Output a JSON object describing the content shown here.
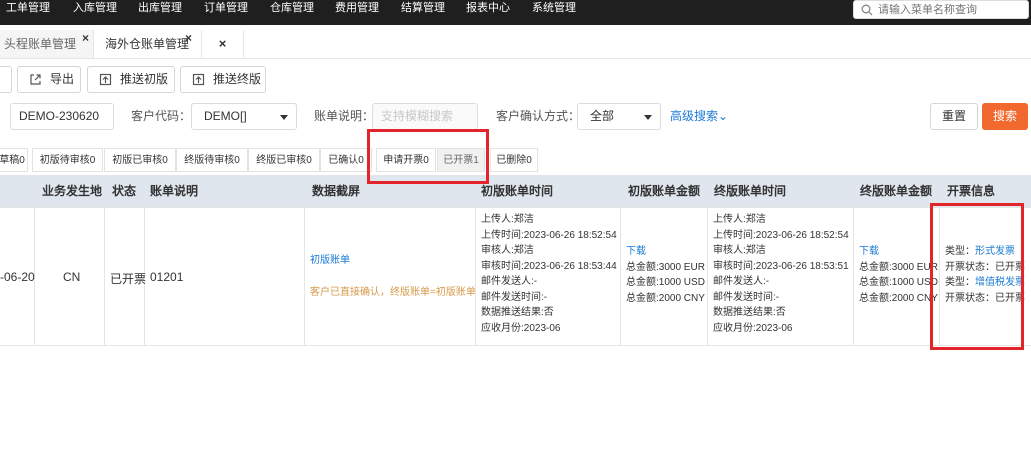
{
  "nav": {
    "items": [
      "工单管理",
      "入库管理",
      "出库管理",
      "订单管理",
      "仓库管理",
      "费用管理",
      "结算管理",
      "报表中心",
      "系统管理"
    ],
    "search_placeholder": "请输入菜单名称查询"
  },
  "tabs": {
    "items": [
      {
        "label": "头程账单管理",
        "close": "×"
      },
      {
        "label": "海外仓账单管理",
        "close": "×"
      }
    ],
    "close_all": "×"
  },
  "toolbar": {
    "export": "导出",
    "push_initial": "推送初版",
    "push_final": "推送终版"
  },
  "filters": {
    "bill_no_value": "DEMO-230620",
    "customer_code_label": "客户代码：",
    "customer_code_value": "DEMO[]",
    "bill_desc_label": "账单说明：",
    "bill_desc_placeholder": "支持模糊搜索",
    "confirm_method_label": "客户确认方式：",
    "confirm_method_value": "全部",
    "advanced_search": "高级搜索⌄",
    "reset": "重置",
    "search": "搜索"
  },
  "status_tabs": [
    "草稿0",
    "初版待审核0",
    "初版已审核0",
    "终版待审核0",
    "终版已审核0",
    "已确认0",
    "申请开票0",
    "已开票1",
    "已删除0"
  ],
  "table": {
    "headers": {
      "location": "业务发生地",
      "status": "状态",
      "desc": "账单说明",
      "screenshot": "数据截屏",
      "initial_time": "初版账单时间",
      "initial_amount": "初版账单金额",
      "final_time": "终版账单时间",
      "final_amount": "终版账单金额",
      "invoice": "开票信息"
    },
    "row": {
      "date_fragment": "-06-20",
      "location": "CN",
      "status": "已开票",
      "desc": "01201",
      "screenshot_link": "初版账单",
      "screenshot_note": "客户已直接确认，终版账单=初版账单",
      "initial_time_lines": [
        "上传人:郑洁",
        "上传时间:2023-06-26 18:52:54",
        "审核人:郑洁",
        "审核时间:2023-06-26 18:53:44",
        "邮件发送人:-",
        "邮件发送时间:-",
        "数据推送结果:否",
        "应收月份:2023-06"
      ],
      "initial_amount_download": "下载",
      "initial_amount_lines": [
        "总金额:3000 EUR",
        "总金额:1000 USD",
        "总金额:2000 CNY"
      ],
      "final_time_lines": [
        "上传人:郑洁",
        "上传时间:2023-06-26 18:52:54",
        "审核人:郑洁",
        "审核时间:2023-06-26 18:53:51",
        "邮件发送人:-",
        "邮件发送时间:-",
        "数据推送结果:否",
        "应收月份:2023-06"
      ],
      "final_amount_download": "下载",
      "final_amount_lines": [
        "总金额:3000 EUR",
        "总金额:1000 USD",
        "总金额:2000 CNY"
      ],
      "invoice_lines": [
        {
          "label": "类型：",
          "value": "形式发票"
        },
        {
          "label": "开票状态：",
          "value": "已开票"
        },
        {
          "label": "类型：",
          "value": "增值税发票"
        },
        {
          "label": "开票状态：",
          "value": "已开票"
        }
      ]
    }
  },
  "colors": {
    "nav_bg": "#1f1f1f",
    "header_bg": "#dfe6ee",
    "accent_orange": "#f2692f",
    "link_blue": "#1a7bd6",
    "highlight_red": "#e3242b"
  }
}
